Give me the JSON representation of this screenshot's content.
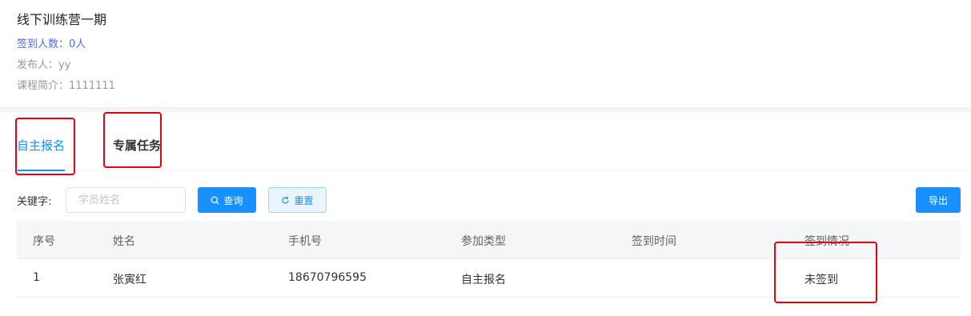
{
  "course": {
    "title": "线下训练营一期",
    "signed_count": "签到人数：0人",
    "publisher": "发布人：yy",
    "summary": "课程简介：1111111"
  },
  "tabs": [
    {
      "label": "自主报名",
      "active": true
    },
    {
      "label": "专属任务",
      "active": false
    }
  ],
  "filter": {
    "keyword_label": "关键字:",
    "search_placeholder": "学员姓名",
    "query_label": "查询",
    "reset_label": "重置",
    "export_label": "导出"
  },
  "table": {
    "headers": [
      "序号",
      "姓名",
      "手机号",
      "参加类型",
      "签到时间",
      "签到情况"
    ],
    "rows": [
      {
        "index": "1",
        "name": "张寅红",
        "phone": "18670796595",
        "type": "自主报名",
        "sign_time": "",
        "status": "未签到"
      }
    ]
  },
  "colors": {
    "accent": "#1890ff",
    "highlight_box": "#e60012",
    "signed_count_text": "#4a6cf7"
  },
  "icons": {
    "query": "search-icon",
    "reset": "refresh-icon"
  }
}
